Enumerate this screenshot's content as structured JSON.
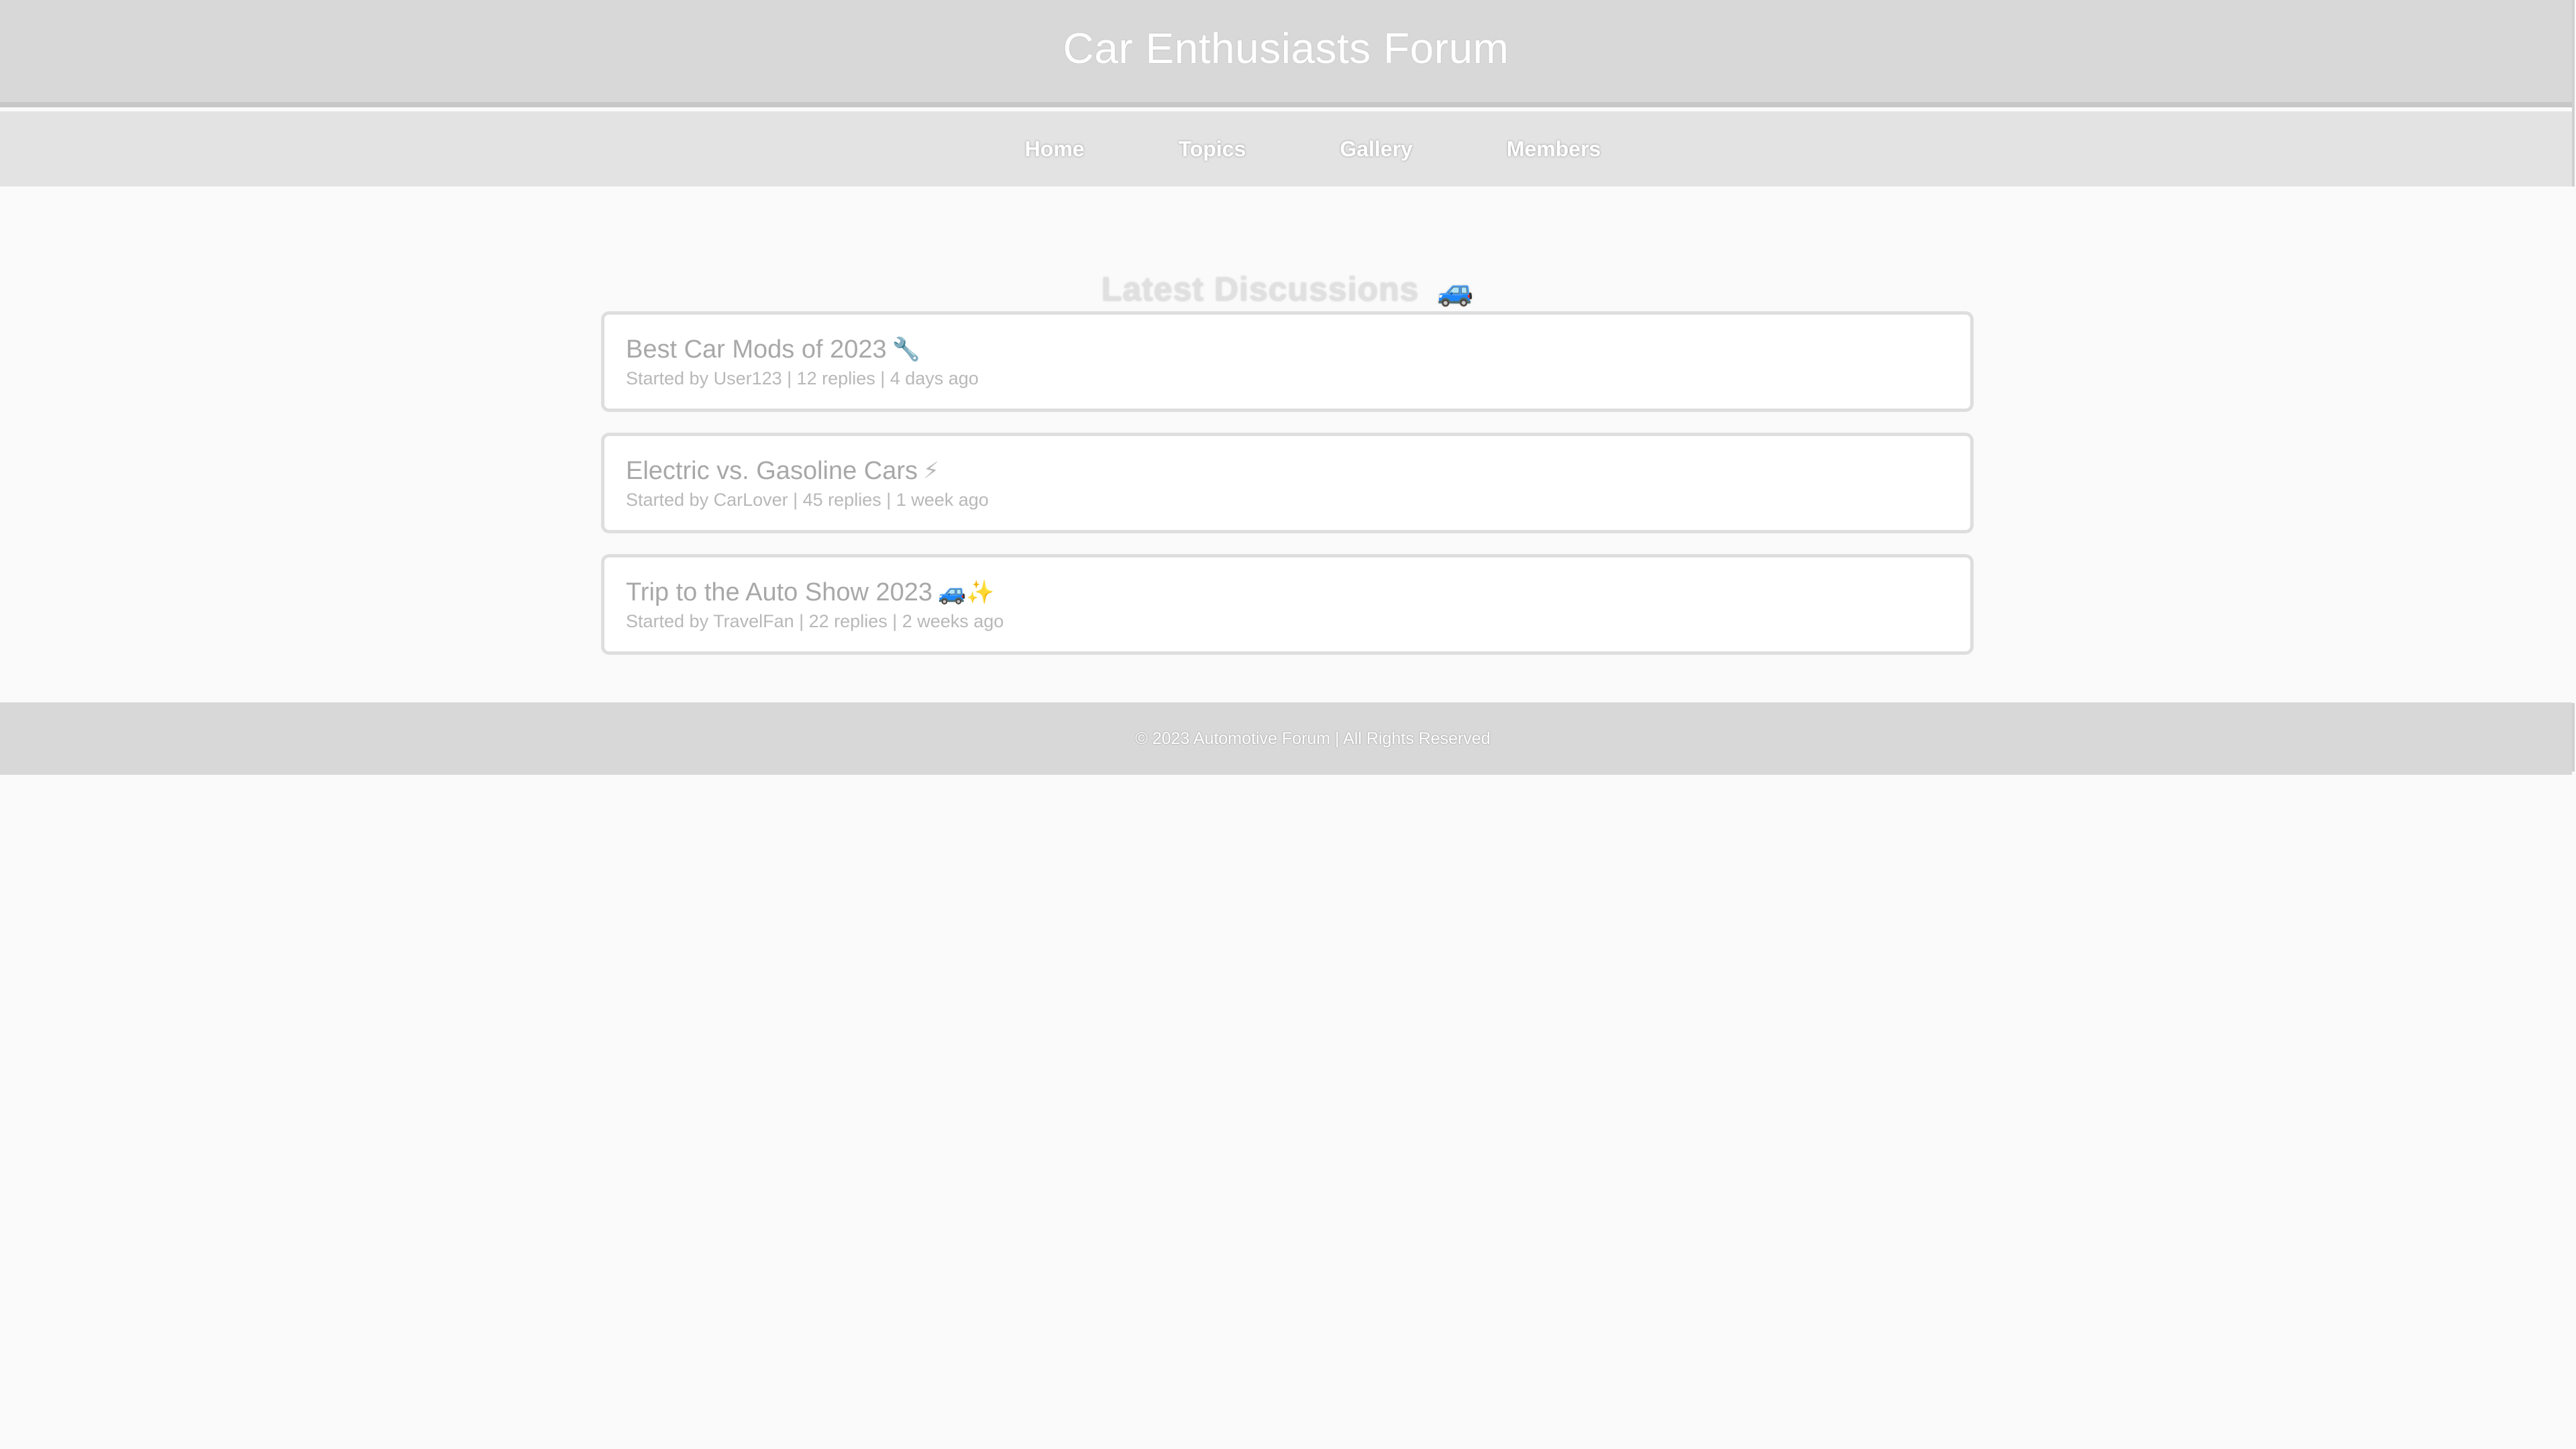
{
  "header": {
    "title": "Car Enthusiasts Forum"
  },
  "nav": {
    "items": [
      {
        "label": "Home"
      },
      {
        "label": "Topics"
      },
      {
        "label": "Gallery"
      },
      {
        "label": "Members"
      }
    ]
  },
  "main": {
    "section_title": "Latest Discussions",
    "section_icon": "car-speech-icon",
    "threads": [
      {
        "title": "Best Car Mods of 2023",
        "icon": "wrench-icon",
        "meta": "Started by User123 | 12 replies | 4 days ago"
      },
      {
        "title": "Electric vs. Gasoline Cars",
        "icon": "lightning-icon",
        "meta": "Started by CarLover | 45 replies | 1 week ago"
      },
      {
        "title": "Trip to the Auto Show 2023",
        "icon": "car-sparkle-icon",
        "meta": "Started by TravelFan | 22 replies | 2 weeks ago"
      }
    ]
  },
  "footer": {
    "text": "© 2023 Automotive Forum | All Rights Reserved"
  },
  "colors": {
    "header_bg": "#d8d8d8",
    "nav_bg": "#e3e3e3",
    "page_bg": "#fafafa",
    "card_border": "#dedede",
    "muted_text": "#a8a8a8"
  }
}
